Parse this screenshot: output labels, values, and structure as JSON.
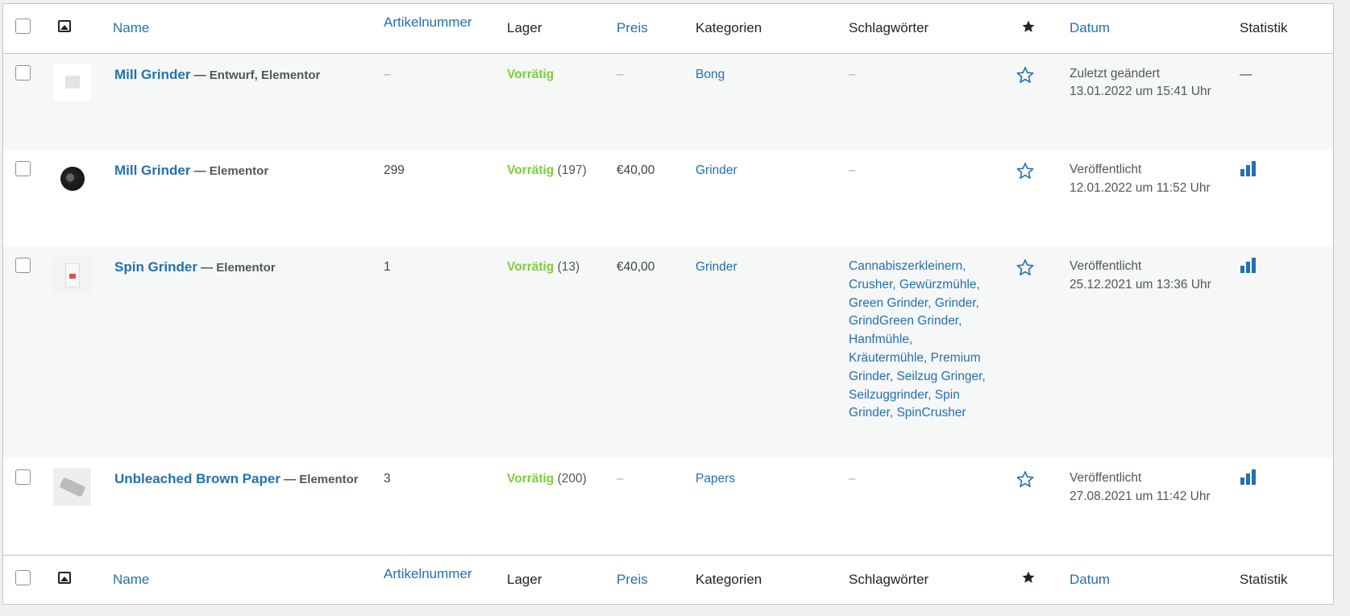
{
  "columns": {
    "name": "Name",
    "sku": "Artikelnummer",
    "stock": "Lager",
    "price": "Preis",
    "categories": "Kategorien",
    "tags": "Schlagwörter",
    "date": "Datum",
    "stats": "Statistik"
  },
  "rows": [
    {
      "name": "Mill Grinder",
      "state": " — Entwurf, Elementor",
      "sku": "–",
      "stock": "Vorrätig",
      "stock_count": "",
      "price": "–",
      "category": "Bong",
      "tags": "–",
      "date_status": "Zuletzt geändert",
      "date_value": "13.01.2022 um 15:41 Uhr",
      "stats": "—"
    },
    {
      "name": "Mill Grinder",
      "state": " — Elementor",
      "sku": "299",
      "stock": "Vorrätig",
      "stock_count": " (197)",
      "price": "€40,00",
      "category": "Grinder",
      "tags": "–",
      "date_status": "Veröffentlicht",
      "date_value": "12.01.2022 um 11:52 Uhr",
      "stats": ""
    },
    {
      "name": "Spin Grinder",
      "state": " — Elementor",
      "sku": "1",
      "stock": "Vorrätig",
      "stock_count": " (13)",
      "price": "€40,00",
      "category": "Grinder",
      "tags": "Cannabiszerkleinern, Crusher, Gewürzmühle, Green Grinder, Grinder, GrindGreen Grinder, Hanfmühle, Kräutermühle, Premium Grinder, Seilzug Gringer, Seilzuggrinder, Spin Grinder, SpinCrusher",
      "date_status": "Veröffentlicht",
      "date_value": "25.12.2021 um 13:36 Uhr",
      "stats": ""
    },
    {
      "name": "Unbleached Brown Paper",
      "state": " — Elementor",
      "sku": "3",
      "stock": "Vorrätig",
      "stock_count": " (200)",
      "price": "–",
      "category": "Papers",
      "tags": "–",
      "date_status": "Veröffentlicht",
      "date_value": "27.08.2021 um 11:42 Uhr",
      "stats": ""
    }
  ],
  "icons": {
    "thumbnail_header": "image-icon",
    "featured_header": "star-filled-icon",
    "featured_row": "star-outline-icon",
    "stats_row": "bar-chart-icon"
  },
  "colors": {
    "link": "#2271b1",
    "in_stock": "#7ad03a"
  }
}
